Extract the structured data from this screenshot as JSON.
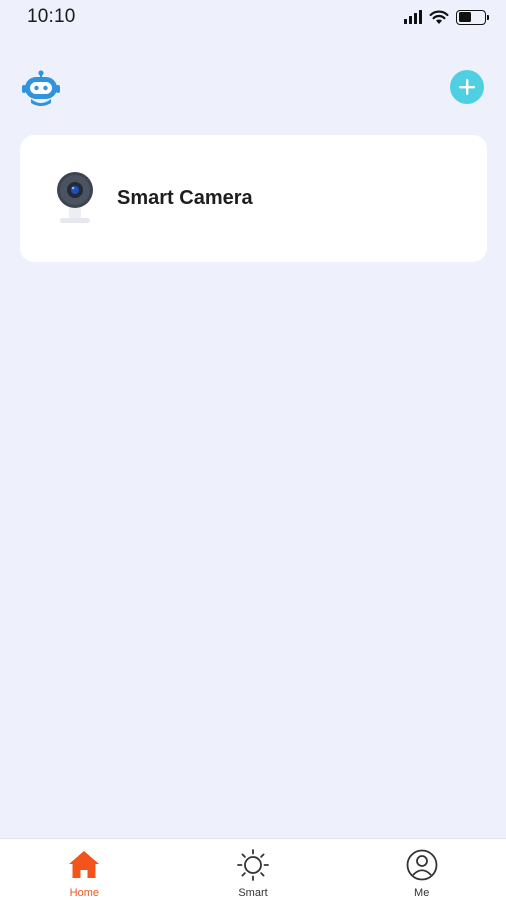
{
  "status_bar": {
    "time": "10:10",
    "icons": [
      "cellular-signal-icon",
      "wifi-icon",
      "battery-icon"
    ],
    "battery_level": 0.5
  },
  "header": {
    "left_icon": "robot-avatar-icon",
    "right_icon": "add-icon"
  },
  "devices": [
    {
      "name": "Smart Camera",
      "icon": "smart-camera-image"
    }
  ],
  "tab_bar": {
    "items": [
      {
        "label": "Home",
        "icon": "home-icon",
        "active": true
      },
      {
        "label": "Smart",
        "icon": "sun-icon",
        "active": false
      },
      {
        "label": "Me",
        "icon": "person-icon",
        "active": false
      }
    ]
  },
  "colors": {
    "background": "#eef1fb",
    "accent": "#f2541b",
    "add_button": "#4ed0e2",
    "robot_blue": "#2f93de"
  }
}
